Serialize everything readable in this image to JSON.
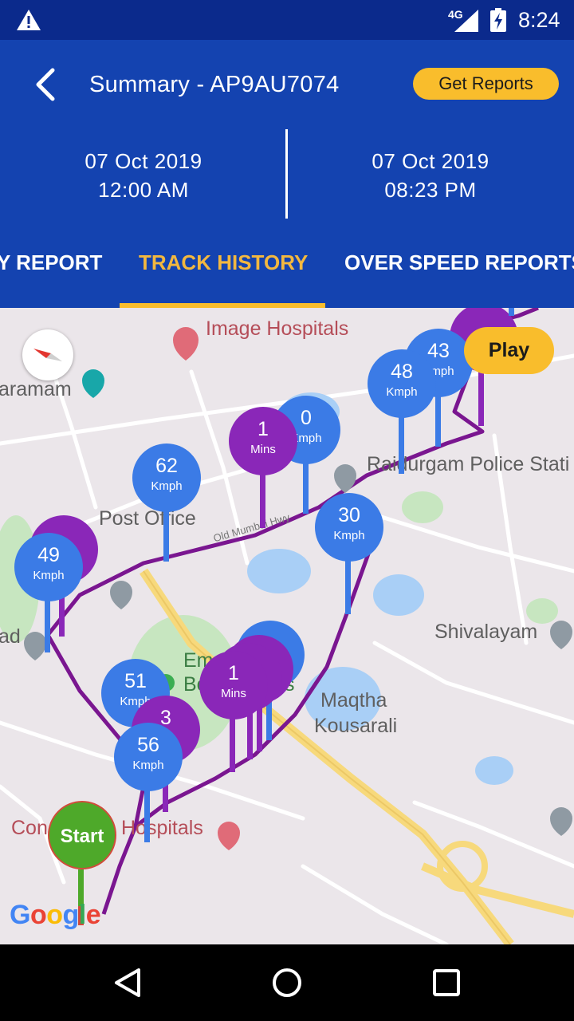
{
  "status_bar": {
    "network": "4G",
    "time": "8:24",
    "icons": [
      "warning-icon",
      "signal-icon",
      "battery-charging-icon"
    ]
  },
  "header": {
    "back_icon": "chevron-left-icon",
    "title": "Summary - AP9AU7074",
    "get_reports_label": "Get Reports",
    "from": {
      "date": "07 Oct 2019",
      "time": "12:00 AM"
    },
    "to": {
      "date": "07 Oct 2019",
      "time": "08:23 PM"
    }
  },
  "tabs": [
    {
      "label": "Y REPORT",
      "active": false
    },
    {
      "label": "TRACK HISTORY",
      "active": true
    },
    {
      "label": "OVER SPEED REPORTS",
      "active": false
    }
  ],
  "map": {
    "labels": {
      "image_hospitals": "Image Hospitals",
      "aramam": "aramam",
      "raidurgam": "Raidurgam Police Stati",
      "post_office": "Post Office",
      "old_mumbai_hwy": "Old Mumbai Hwy",
      "shivalayam": "Shivalayam",
      "ad": "ad",
      "maqtha": "Maqtha",
      "kousarali": "Kousarali",
      "em": "Em",
      "bo": "Bo",
      "s": "s",
      "con": "Con",
      "hospitals": "Hospitals",
      "google": "Google"
    },
    "play_label": "Play",
    "start_label": "Start",
    "markers": [
      {
        "value": "43",
        "unit": "Kmph",
        "color": "blue"
      },
      {
        "value": "48",
        "unit": "Kmph",
        "color": "blue"
      },
      {
        "value": "0",
        "unit": "Kmph",
        "color": "blue"
      },
      {
        "value": "1",
        "unit": "Mins",
        "color": "purple"
      },
      {
        "value": "62",
        "unit": "Kmph",
        "color": "blue"
      },
      {
        "value": "30",
        "unit": "Kmph",
        "color": "blue"
      },
      {
        "value": "49",
        "unit": "Kmph",
        "color": "blue"
      },
      {
        "value": "1",
        "unit": "Mins",
        "color": "purple"
      },
      {
        "value": "51",
        "unit": "Kmph",
        "color": "blue"
      },
      {
        "value": "3",
        "unit": "",
        "color": "purple"
      },
      {
        "value": "56",
        "unit": "Kmph",
        "color": "blue"
      }
    ]
  },
  "colors": {
    "header": "#1443b0",
    "status_bar": "#0b2a8c",
    "accent": "#f9bd2c",
    "route": "#7a1690",
    "speed_marker": "#3b7be6",
    "stop_marker": "#8a27b8",
    "start_marker": "#4ea92a"
  },
  "nav_bar": {
    "icons": [
      "back-triangle-icon",
      "home-circle-icon",
      "recents-square-icon"
    ]
  }
}
